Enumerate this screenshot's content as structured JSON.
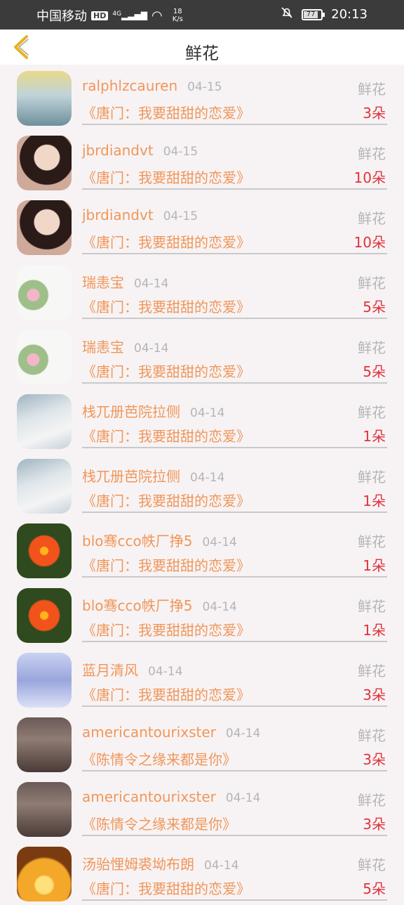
{
  "status": {
    "carrier": "中国移动",
    "hd": "HD",
    "signal_type": "4G",
    "speed_value": "18",
    "speed_unit": "K/s",
    "battery": "77",
    "time": "20:13"
  },
  "header": {
    "title": "鲜花",
    "back_icon": "chevron-left-icon"
  },
  "colors": {
    "accent": "#f0965a",
    "count": "#e0323c",
    "muted": "#b5b5b5"
  },
  "items": [
    {
      "name": "ralphlzcauren",
      "date": "04-15",
      "gift": "鲜花",
      "book": "《唐门：我要甜甜的恋爱》",
      "count": "3朵"
    },
    {
      "name": "jbrdiandvt",
      "date": "04-15",
      "gift": "鲜花",
      "book": "《唐门：我要甜甜的恋爱》",
      "count": "10朵"
    },
    {
      "name": "jbrdiandvt",
      "date": "04-15",
      "gift": "鲜花",
      "book": "《唐门：我要甜甜的恋爱》",
      "count": "10朵"
    },
    {
      "name": "瑞恚宝",
      "date": "04-14",
      "gift": "鲜花",
      "book": "《唐门：我要甜甜的恋爱》",
      "count": "5朵"
    },
    {
      "name": "瑞恚宝",
      "date": "04-14",
      "gift": "鲜花",
      "book": "《唐门：我要甜甜的恋爱》",
      "count": "5朵"
    },
    {
      "name": "栈兀册芭院拉侧",
      "date": "04-14",
      "gift": "鲜花",
      "book": "《唐门：我要甜甜的恋爱》",
      "count": "1朵"
    },
    {
      "name": "栈兀册芭院拉侧",
      "date": "04-14",
      "gift": "鲜花",
      "book": "《唐门：我要甜甜的恋爱》",
      "count": "1朵"
    },
    {
      "name": "blo骞cco帙厂挣5",
      "date": "04-14",
      "gift": "鲜花",
      "book": "《唐门：我要甜甜的恋爱》",
      "count": "1朵"
    },
    {
      "name": "blo骞cco帙厂挣5",
      "date": "04-14",
      "gift": "鲜花",
      "book": "《唐门：我要甜甜的恋爱》",
      "count": "1朵"
    },
    {
      "name": "蓝月清风",
      "date": "04-14",
      "gift": "鲜花",
      "book": "《唐门：我要甜甜的恋爱》",
      "count": "3朵"
    },
    {
      "name": "americantourixster",
      "date": "04-14",
      "gift": "鲜花",
      "book": "《陈情令之缘来都是你》",
      "count": "3朵"
    },
    {
      "name": "americantourixster",
      "date": "04-14",
      "gift": "鲜花",
      "book": "《陈情令之缘来都是你》",
      "count": "3朵"
    },
    {
      "name": "汤骀悝姆裘坳布朗",
      "date": "04-14",
      "gift": "鲜花",
      "book": "《唐门：我要甜甜的恋爱》",
      "count": "5朵"
    }
  ]
}
